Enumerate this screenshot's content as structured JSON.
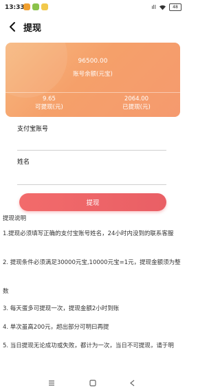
{
  "status_bar": {
    "time": "13:33",
    "signal_text": "ıll",
    "battery": "48"
  },
  "header": {
    "back_icon": "chevron-left-icon",
    "title": "提现"
  },
  "balance_card": {
    "balance": "96500.00",
    "balance_label": "账号余额(元宝)",
    "withdrawable_value": "9.65",
    "withdrawable_label": "可提现(元)",
    "withdrawn_value": "2064.00",
    "withdrawn_label": "已提现(元)"
  },
  "form": {
    "alipay_label": "支付宝账号",
    "alipay_value": "",
    "name_label": "姓名",
    "name_value": "",
    "submit_label": "提现"
  },
  "instructions": {
    "title": "提现说明",
    "items": [
      "1.提现必须填写正确的支付宝账号姓名，24小时内没到的联系客服",
      "2. 提现条件必须满足30000元宝,10000元宝=1元，提现金额须为整",
      "数",
      "3. 每天蛋多可提现一次，提现金额2小时到账",
      "4. 单次虽高200元，超出部分可明曰再提",
      "5. 当日提现无论成功或失败，都计为一次，当日不可提现，请于明"
    ]
  },
  "nav_bar": {
    "menu_icon": "menu-icon",
    "home_icon": "square-home-icon",
    "back_icon": "triangle-back-icon"
  },
  "colors": {
    "card_gradient_start": "#f7b87f",
    "card_gradient_end": "#f59a6e",
    "button": "#f26b6b"
  }
}
